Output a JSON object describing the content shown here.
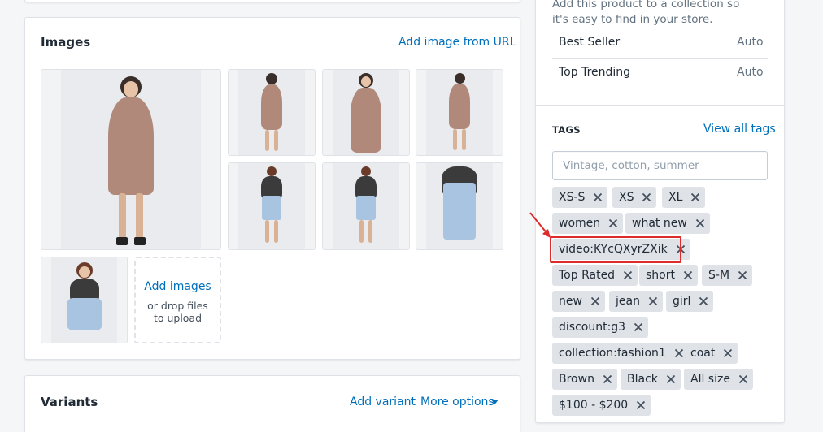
{
  "images_card": {
    "title": "Images",
    "add_url_link": "Add image from URL",
    "dropzone": {
      "link": "Add images",
      "hint": "or drop files to upload"
    }
  },
  "variants_card": {
    "title": "Variants",
    "add_variant": "Add variant",
    "more_options": "More options"
  },
  "collections": {
    "help_text": "Add this product to a collection so it's easy to find in your store.",
    "items": [
      {
        "name": "Best Seller",
        "type": "Auto"
      },
      {
        "name": "Top Trending",
        "type": "Auto"
      }
    ]
  },
  "tags_section": {
    "label": "TAGS",
    "view_all": "View all tags",
    "input_placeholder": "Vintage, cotton, summer",
    "tags": [
      "XS-S",
      "XS",
      "XL",
      "women",
      "what new",
      "video:KYcQXyrZXik",
      "Top Rated",
      "short",
      "S-M",
      "new",
      "jean",
      "girl",
      "discount:g3",
      "collection:fashion1",
      "coat",
      "Brown",
      "Black",
      "All size",
      "$100 - $200"
    ],
    "highlighted_tag": "video:KYcQXyrZXik"
  },
  "colors": {
    "link": "#006fbb",
    "tag_bg": "#dfe3e8",
    "highlight": "#de2b2b"
  }
}
